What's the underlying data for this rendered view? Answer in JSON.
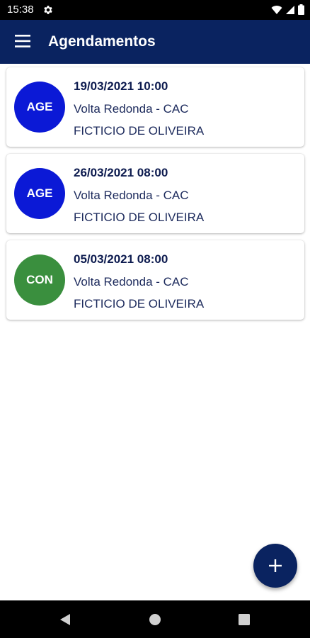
{
  "status_bar": {
    "time": "15:38",
    "icons": [
      "settings-icon",
      "wifi-icon",
      "signal-icon",
      "battery-icon"
    ]
  },
  "app_bar": {
    "title": "Agendamentos",
    "menu_icon": "hamburger-menu-icon",
    "color": "#0a2360"
  },
  "appointments": [
    {
      "badge": "AGE",
      "badge_color": "#0b19d6",
      "datetime": "19/03/2021 10:00",
      "location": "Volta Redonda - CAC",
      "name": "FICTICIO DE OLIVEIRA"
    },
    {
      "badge": "AGE",
      "badge_color": "#0b19d6",
      "datetime": "26/03/2021 08:00",
      "location": "Volta Redonda - CAC",
      "name": "FICTICIO DE OLIVEIRA"
    },
    {
      "badge": "CON",
      "badge_color": "#3a8f3e",
      "datetime": "05/03/2021 08:00",
      "location": "Volta Redonda - CAC",
      "name": "FICTICIO DE OLIVEIRA"
    }
  ],
  "fab": {
    "icon": "plus-icon",
    "color": "#0a2360"
  },
  "nav_bar": {
    "icons": [
      "back-icon",
      "home-icon",
      "recents-icon"
    ]
  }
}
